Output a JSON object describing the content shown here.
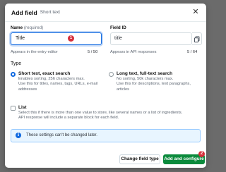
{
  "dialog": {
    "title": "Add field",
    "subtitle": "Short text",
    "close_icon": "close-icon"
  },
  "name_field": {
    "label": "Name",
    "required_label": "(required)",
    "value": "Title",
    "help": "Appears in the entry editor",
    "count": "5 / 50",
    "badge": "1"
  },
  "id_field": {
    "label": "Field ID",
    "value": "title",
    "help": "Appears in API responses",
    "count": "5 / 64",
    "copy_icon": "copy-icon"
  },
  "type_section": {
    "title": "Type",
    "options": [
      {
        "title": "Short text, exact search",
        "desc_lines": [
          "Enables sorting, 256 characters max.",
          "Use this for titles, names, tags, URLs, e-mail",
          "addresses"
        ],
        "selected": true
      },
      {
        "title": "Long text, full-text search",
        "desc_lines": [
          "No sorting, 50k characters max.",
          "Use this for descriptions, text paragraphs,",
          "articles"
        ],
        "selected": false
      }
    ]
  },
  "list_option": {
    "title": "List",
    "desc_lines": [
      "Select this if there is more than one value to store, like several names or a list of ingredients.",
      "API response will include a separate block for each field."
    ],
    "checked": false
  },
  "info_note": {
    "icon": "info-icon",
    "text": "These settings can't be changed later."
  },
  "footer": {
    "secondary_label": "Change field type",
    "primary_label": "Add and configure",
    "primary_badge": "2"
  },
  "colors": {
    "primary": "#0e68e0",
    "success": "#0b8a3c",
    "badge": "#d62e3a",
    "info_bg": "#e8f5ff"
  }
}
